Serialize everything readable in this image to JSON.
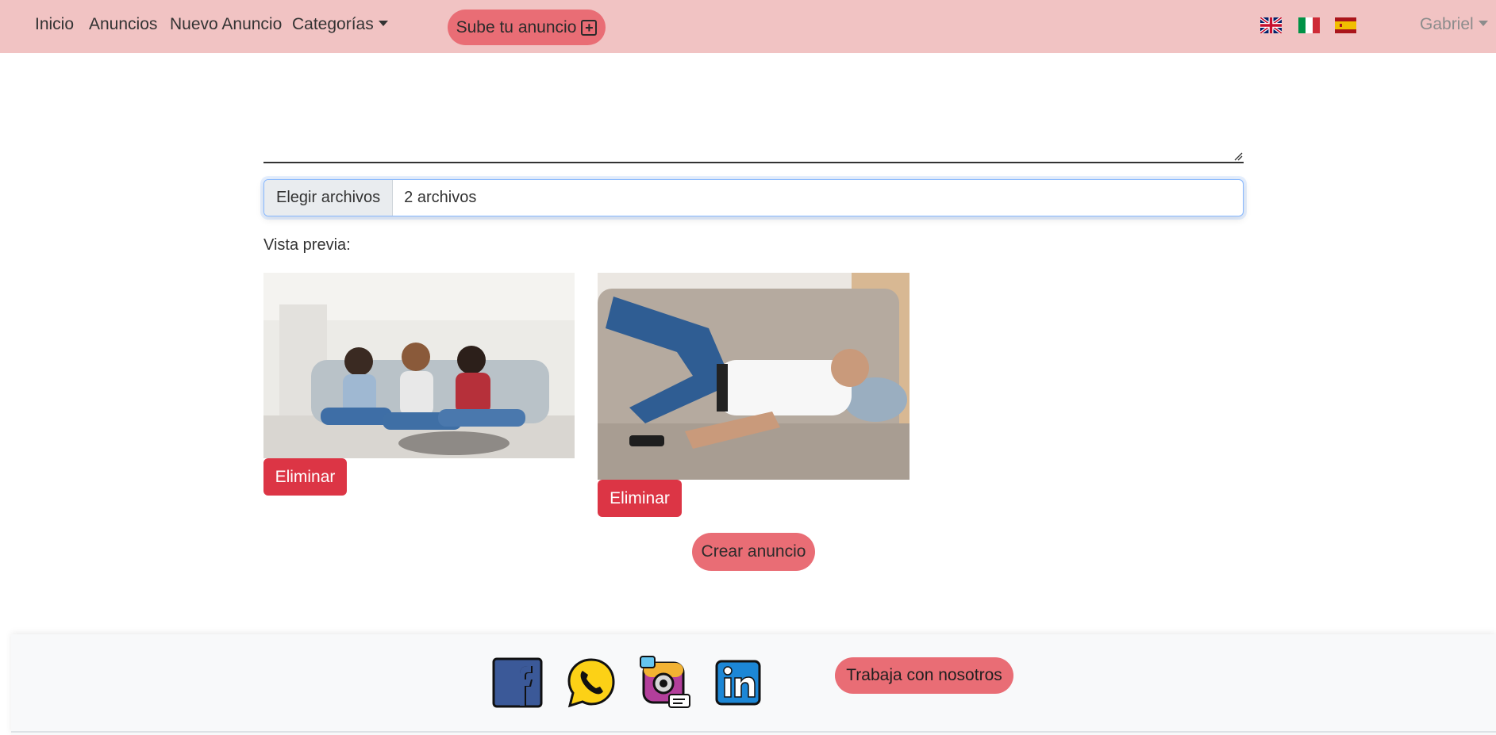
{
  "nav": {
    "items": [
      {
        "label": "Inicio"
      },
      {
        "label": "Anuncios"
      },
      {
        "label": "Nuevo Anuncio"
      },
      {
        "label": "Categorías"
      }
    ],
    "upload_label": "Sube tu anuncio",
    "languages": [
      "english-flag",
      "italian-flag",
      "spanish-flag"
    ],
    "user_name": "Gabriel"
  },
  "form": {
    "file_button_label": "Elegir archivos",
    "file_status": "2 archivos",
    "preview_label": "Vista previa:",
    "previews": [
      {
        "delete_label": "Eliminar"
      },
      {
        "delete_label": "Eliminar"
      }
    ],
    "submit_label": "Crear anuncio"
  },
  "footer": {
    "social": [
      "facebook-icon",
      "whatsapp-icon",
      "instagram-icon",
      "linkedin-icon"
    ],
    "work_label": "Trabaja con nosotros"
  },
  "colors": {
    "navbar": "#f1c3c3",
    "accent": "#e96d75",
    "danger": "#dc3545",
    "footer": "#f8f9fa"
  }
}
